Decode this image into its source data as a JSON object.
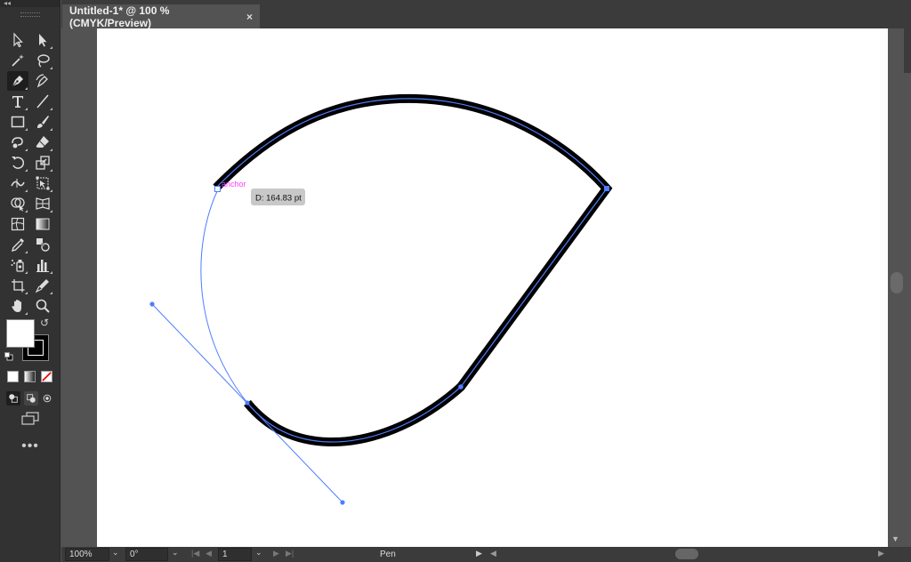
{
  "document": {
    "tab_title": "Untitled-1* @ 100 % (CMYK/Preview)",
    "close_glyph": "×"
  },
  "canvas": {
    "anchor_label": "anchor",
    "distance_tooltip": "D: 164.83 pt",
    "stroke_color": "#000000",
    "path_color": "#4f7dff",
    "label_color": "#ff3cff"
  },
  "toolbar": {
    "collapse_glyph": "◂◂",
    "tools": [
      "selection-tool-icon",
      "direct-selection-tool-icon",
      "magic-wand-tool-icon",
      "lasso-tool-icon",
      "pen-tool-icon",
      "curvature-tool-icon",
      "type-tool-icon",
      "line-segment-tool-icon",
      "rectangle-tool-icon",
      "paintbrush-tool-icon",
      "shaper-tool-icon",
      "eraser-tool-icon",
      "rotate-tool-icon",
      "scale-tool-icon",
      "width-tool-icon",
      "free-transform-tool-icon",
      "shape-builder-tool-icon",
      "perspective-grid-tool-icon",
      "mesh-tool-icon",
      "gradient-tool-icon",
      "eyedropper-tool-icon",
      "blend-tool-icon",
      "symbol-sprayer-tool-icon",
      "column-graph-tool-icon",
      "artboard-tool-icon",
      "slice-tool-icon",
      "hand-tool-icon",
      "zoom-tool-icon"
    ],
    "active_tool": "pen-tool-icon",
    "swap_glyph": "↺",
    "more_glyph": "•••"
  },
  "statusbar": {
    "zoom": "100%",
    "rotation": "0°",
    "artboard_number": "1",
    "current_tool": "Pen",
    "dropdown_glyph": "⌄",
    "play_glyph": "▶",
    "left_glyph": "◀",
    "right_glyph": "▶"
  }
}
